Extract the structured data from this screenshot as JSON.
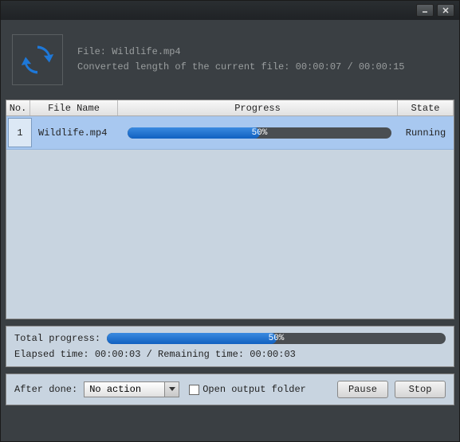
{
  "info": {
    "file_label": "File: Wildlife.mp4",
    "converted_label": "Converted length of the current file: 00:00:07 / 00:00:15"
  },
  "table": {
    "headers": {
      "no": "No.",
      "file": "File Name",
      "progress": "Progress",
      "state": "State"
    },
    "rows": [
      {
        "no": "1",
        "file": "Wildlife.mp4",
        "percent": 50,
        "percent_label": "50%",
        "state": "Running"
      }
    ]
  },
  "total": {
    "label": "Total progress:",
    "percent": 50,
    "percent_label": "50%",
    "elapsed_label": "Elapsed time: 00:00:03 / Remaining time: 00:00:03"
  },
  "footer": {
    "after_done_label": "After done:",
    "dropdown_value": "No action",
    "open_folder_label": "Open output folder",
    "pause_label": "Pause",
    "stop_label": "Stop"
  }
}
